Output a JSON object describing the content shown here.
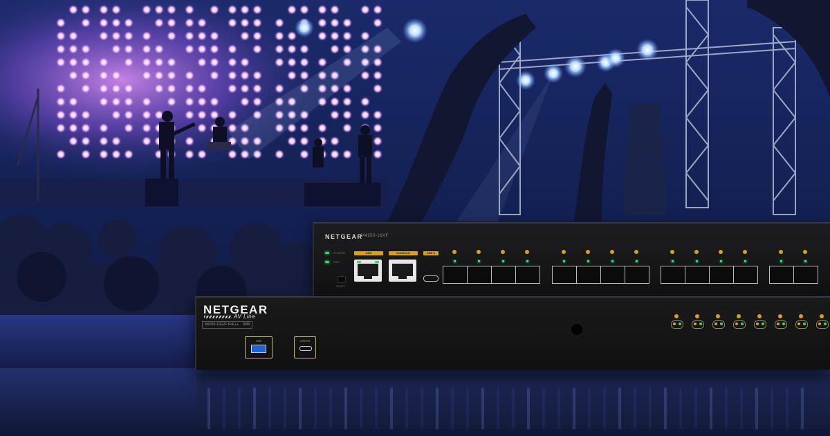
{
  "scene": {
    "palette": {
      "sky": "#0d1230",
      "stage_glow": "#b463e8",
      "crowd": "#1a2140",
      "accent": "#d9a11a",
      "led_green": "#2fe06a",
      "usb_blue": "#1d63d6"
    }
  },
  "switch_top": {
    "brand": "NETGEAR",
    "model": "M4250-16XF",
    "power_label": "POWER",
    "fan_label": "FAN",
    "reset_label": "RESET",
    "usb_label": "USB",
    "console_label": "CONSOLE",
    "usbc_label": "USB C"
  },
  "switch_front": {
    "brand": "NETGEAR",
    "line": "AV Line",
    "model": "M4250-10G2F-PoE++",
    "power": "90W",
    "usb_label": "USB",
    "usbc_label": "USB PD"
  }
}
